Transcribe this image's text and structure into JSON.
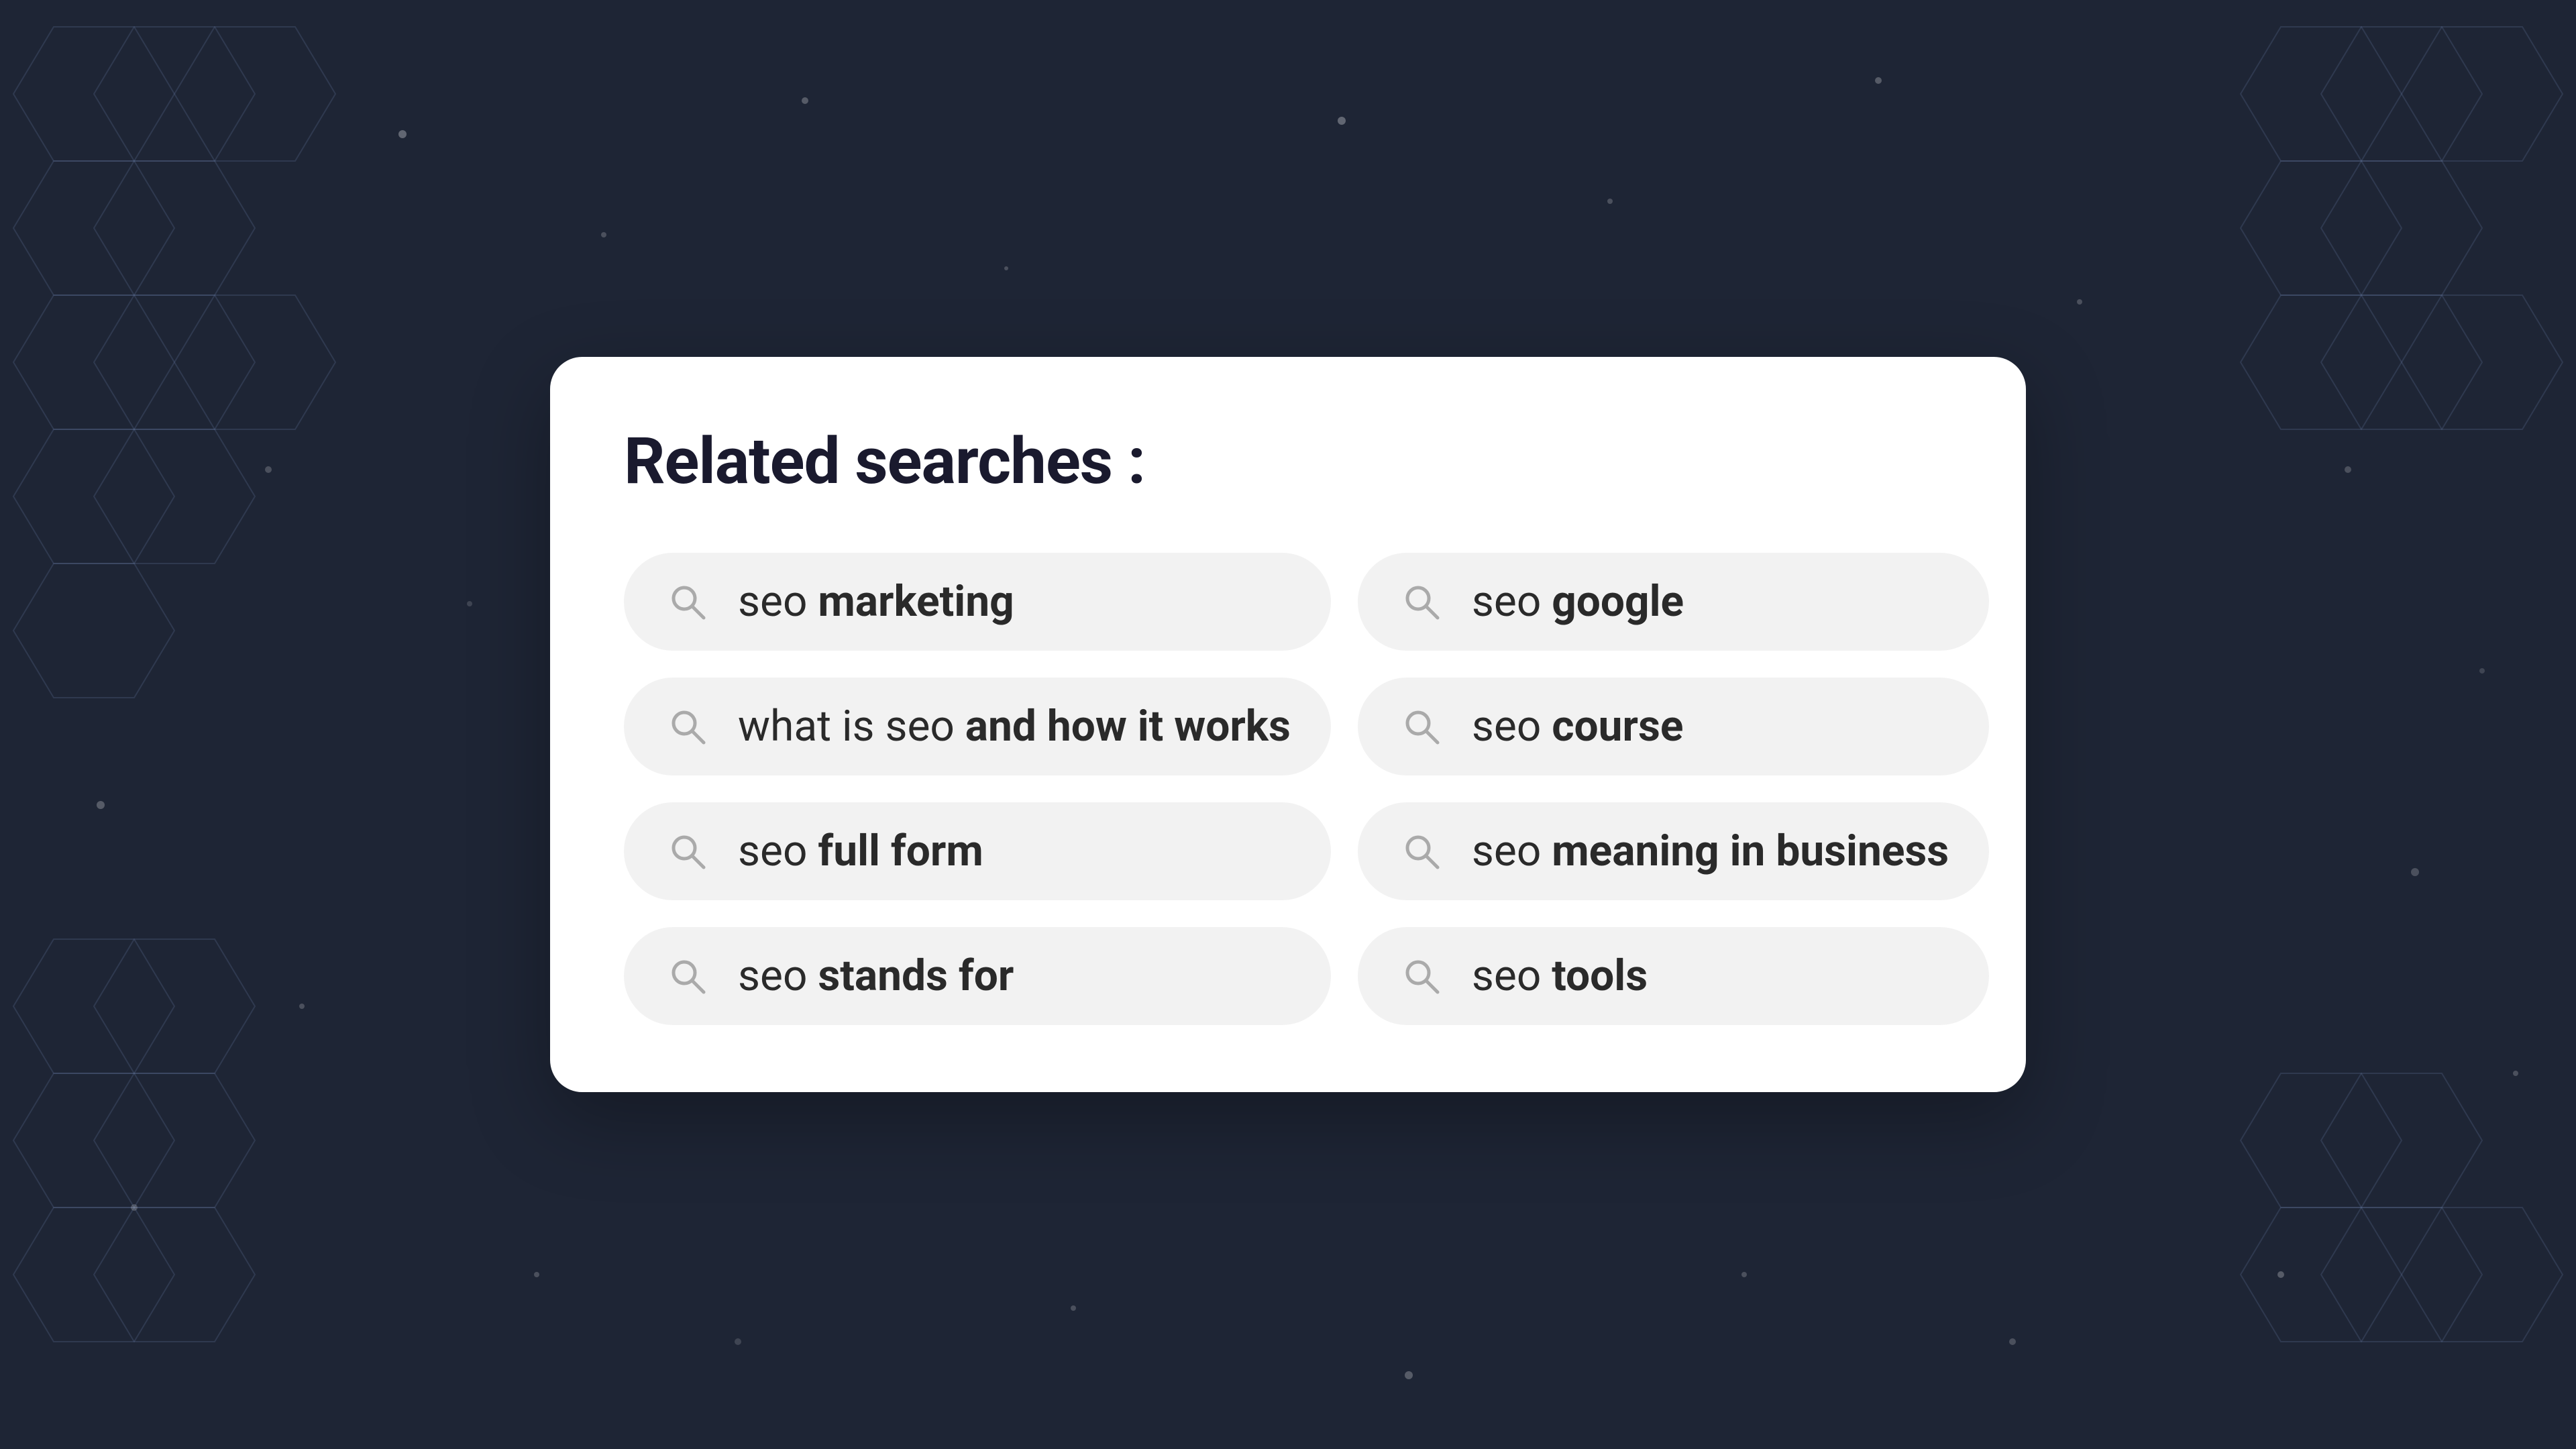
{
  "background": {
    "color": "#1e2535"
  },
  "card": {
    "title": "Related searches  :",
    "searches": [
      {
        "id": "seo-marketing",
        "prefix": "seo ",
        "suffix": "marketing",
        "col": 0
      },
      {
        "id": "seo-google",
        "prefix": "seo ",
        "suffix": "google",
        "col": 1
      },
      {
        "id": "what-is-seo",
        "prefix": "what is seo ",
        "suffix": "and how it works",
        "col": 0
      },
      {
        "id": "seo-course",
        "prefix": "seo ",
        "suffix": "course",
        "col": 1
      },
      {
        "id": "seo-full-form",
        "prefix": "seo ",
        "suffix": "full form",
        "col": 0
      },
      {
        "id": "seo-meaning",
        "prefix": "seo ",
        "suffix": "meaning in business",
        "col": 1
      },
      {
        "id": "seo-stands-for",
        "prefix": "seo ",
        "suffix": "stands for",
        "col": 0
      },
      {
        "id": "seo-tools",
        "prefix": "seo ",
        "suffix": "tools",
        "col": 1
      }
    ]
  }
}
